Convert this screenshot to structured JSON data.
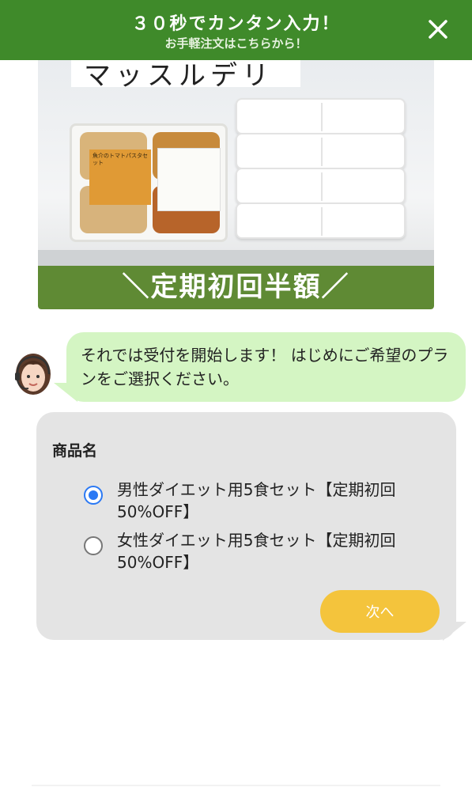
{
  "banner": {
    "title": "３０秒でカンタン入力！",
    "subtitle": "お手軽注文はこちらから！",
    "close_icon": "close-icon"
  },
  "hero": {
    "brand_text": "マッスルデリ",
    "package_label": "魚介のトマトパスタセット",
    "campaign_text": "＼定期初回半額／",
    "colors": {
      "campaign_band": "#5f8a34"
    }
  },
  "chat": {
    "operator_avatar": "operator-avatar",
    "message": "それでは受付を開始します！ はじめにご希望のプランをご選択ください。"
  },
  "form": {
    "field_label": "商品名",
    "options": [
      {
        "label": "男性ダイエット用5食セット【定期初回50%OFF】",
        "selected": true
      },
      {
        "label": "女性ダイエット用5食セット【定期初回50%OFF】",
        "selected": false
      }
    ],
    "next_label": "次へ",
    "colors": {
      "radio_selected": "#2b79f4",
      "next_button": "#f4c43c"
    }
  },
  "colors": {
    "banner": "#3f8a2a",
    "chat_bubble": "#d4f5c3",
    "form_card": "#e4e4e4"
  }
}
